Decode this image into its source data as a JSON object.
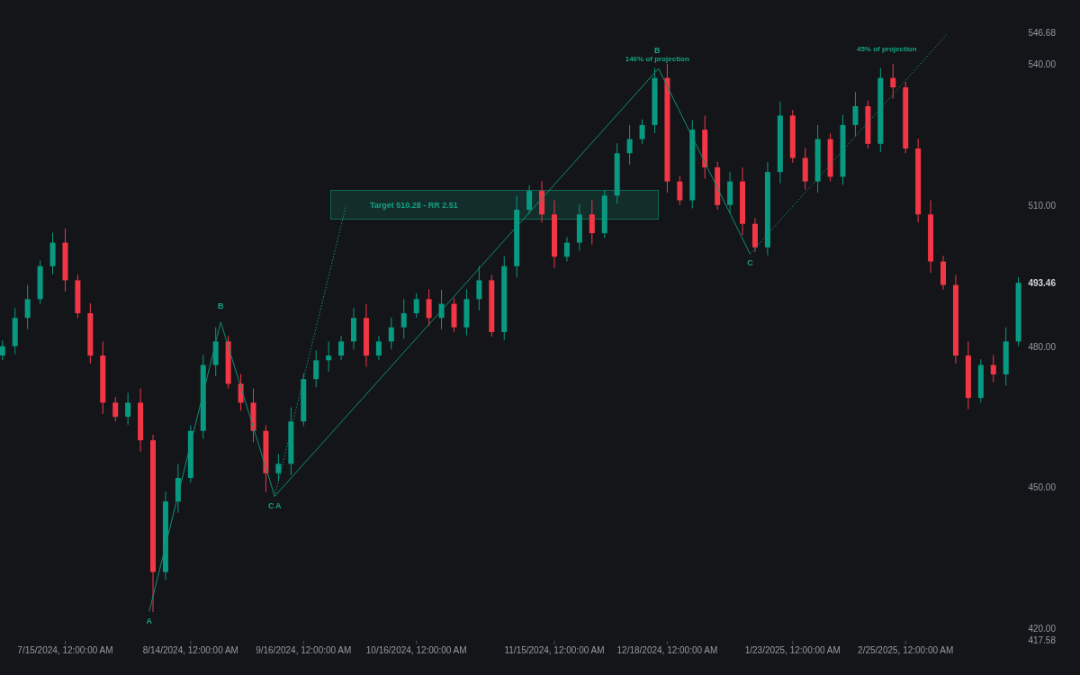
{
  "chart": {
    "chart_data": {
      "type": "candlestick",
      "ylim": [
        417.58,
        546.68
      ],
      "yticks": [
        {
          "value": 546.68,
          "label": "546.68"
        },
        {
          "value": 540,
          "label": "540.00"
        },
        {
          "value": 510,
          "label": "510.00"
        },
        {
          "value": 480,
          "label": "480.00"
        },
        {
          "value": 450,
          "label": "450.00"
        },
        {
          "value": 420,
          "label": "420.00"
        },
        {
          "value": 417.58,
          "label": "417.58"
        }
      ],
      "categories": [
        null,
        null,
        null,
        null,
        null,
        "7/15/2024, 12:00:00 AM",
        null,
        null,
        null,
        null,
        null,
        null,
        null,
        null,
        null,
        "8/14/2024, 12:00:00 AM",
        null,
        null,
        null,
        null,
        null,
        null,
        null,
        null,
        "9/16/2024, 12:00:00 AM",
        null,
        null,
        null,
        null,
        null,
        null,
        null,
        null,
        "10/16/2024, 12:00:00 AM",
        null,
        null,
        null,
        null,
        null,
        null,
        null,
        null,
        null,
        null,
        "11/15/2024, 12:00:00 AM",
        null,
        null,
        null,
        null,
        null,
        null,
        null,
        null,
        "12/18/2024, 12:00:00 AM",
        null,
        null,
        null,
        null,
        null,
        null,
        null,
        null,
        null,
        "1/23/2025, 12:00:00 AM",
        null,
        null,
        null,
        null,
        null,
        null,
        null,
        null,
        "2/25/2025, 12:00:00 AM",
        null,
        null,
        null,
        null,
        null,
        null,
        null,
        null,
        null
      ],
      "ohlc": [
        [
          478,
          481.2,
          477,
          480
        ],
        [
          480,
          488.1,
          478.3,
          486
        ],
        [
          486,
          493,
          483.6,
          490
        ],
        [
          490,
          498.2,
          489,
          497
        ],
        [
          497,
          504.1,
          495.3,
          502
        ],
        [
          502,
          505,
          491.6,
          494
        ],
        [
          494,
          495.2,
          486,
          487
        ],
        [
          487,
          489.1,
          476.3,
          478
        ],
        [
          478,
          481,
          465.6,
          468
        ],
        [
          468,
          469.2,
          464,
          465
        ],
        [
          465,
          470.1,
          463.3,
          468
        ],
        [
          468,
          471,
          457.6,
          460
        ],
        [
          460,
          461.2,
          423.5,
          432
        ],
        [
          432,
          449.1,
          430.3,
          447
        ],
        [
          447,
          455,
          444.6,
          452
        ],
        [
          452,
          463.2,
          451,
          462
        ],
        [
          462,
          478.1,
          460.3,
          476
        ],
        [
          476,
          484,
          473.6,
          481
        ],
        [
          481,
          482.2,
          471,
          472
        ],
        [
          472,
          474.1,
          466.3,
          468
        ],
        [
          468,
          471,
          459.6,
          462
        ],
        [
          462,
          463.2,
          449,
          453
        ],
        [
          453,
          457.1,
          451.3,
          455
        ],
        [
          455,
          467,
          452.6,
          464
        ],
        [
          464,
          474.2,
          463,
          473
        ],
        [
          473,
          479.1,
          471.3,
          477
        ],
        [
          477,
          481,
          474.6,
          478
        ],
        [
          478,
          482.2,
          477,
          481
        ],
        [
          481,
          488.1,
          479.3,
          486
        ],
        [
          486,
          489,
          475.6,
          478
        ],
        [
          478,
          482.2,
          477,
          481
        ],
        [
          481,
          486.1,
          479.3,
          484
        ],
        [
          484,
          490,
          481.6,
          487
        ],
        [
          487,
          491.2,
          486,
          490
        ],
        [
          490,
          492.1,
          484.3,
          486
        ],
        [
          486,
          492,
          483.6,
          489
        ],
        [
          489,
          490.2,
          483,
          484
        ],
        [
          484,
          492.1,
          482.3,
          490
        ],
        [
          490,
          497,
          487.6,
          494
        ],
        [
          494,
          495.2,
          482,
          483
        ],
        [
          483,
          499.1,
          481.3,
          497
        ],
        [
          497,
          512,
          494.6,
          509
        ],
        [
          509,
          514.2,
          508,
          513
        ],
        [
          513,
          515.1,
          506.3,
          508
        ],
        [
          508,
          511,
          496.6,
          499
        ],
        [
          499,
          503.2,
          498,
          502
        ],
        [
          502,
          510.1,
          500.3,
          508
        ],
        [
          508,
          511,
          501.6,
          504
        ],
        [
          504,
          513.2,
          503,
          512
        ],
        [
          512,
          523.1,
          510.3,
          521
        ],
        [
          521,
          527,
          518.6,
          524
        ],
        [
          524,
          528.2,
          523,
          527
        ],
        [
          527,
          539.1,
          525.3,
          537
        ],
        [
          537,
          540,
          512.6,
          515
        ],
        [
          515,
          516.2,
          510,
          511
        ],
        [
          511,
          528.1,
          509.3,
          526
        ],
        [
          526,
          529,
          515.6,
          518
        ],
        [
          518,
          519.2,
          509,
          510
        ],
        [
          510,
          517.1,
          508.3,
          515
        ],
        [
          515,
          518,
          503.6,
          506
        ],
        [
          506,
          507.2,
          500,
          501
        ],
        [
          501,
          519.1,
          499.3,
          517
        ],
        [
          517,
          532,
          514.6,
          529
        ],
        [
          529,
          530.2,
          519,
          520
        ],
        [
          520,
          522.1,
          513.3,
          515
        ],
        [
          515,
          527,
          512.6,
          524
        ],
        [
          524,
          525.2,
          515,
          516
        ],
        [
          516,
          529.1,
          514.3,
          527
        ],
        [
          527,
          534,
          524.6,
          531
        ],
        [
          531,
          532.2,
          522,
          523
        ],
        [
          523,
          539.1,
          521.3,
          537
        ],
        [
          537,
          540,
          532.6,
          535
        ],
        [
          535,
          536.2,
          521,
          522
        ],
        [
          522,
          524.1,
          506.3,
          508
        ],
        [
          508,
          511,
          495.6,
          498
        ],
        [
          498,
          499.2,
          492,
          493
        ],
        [
          493,
          495.1,
          476.3,
          478
        ],
        [
          478,
          481,
          466.6,
          469
        ],
        [
          469,
          477.2,
          468,
          476
        ],
        [
          476,
          478.1,
          472.3,
          474
        ],
        [
          474,
          484,
          471.6,
          481
        ],
        [
          481,
          494.7,
          480,
          493.46
        ]
      ]
    },
    "last_price": "493.46",
    "target": {
      "text": "Target 510.28 - RR 2.51"
    },
    "pattern_labels": [
      {
        "text": "A"
      },
      {
        "text": "B"
      },
      {
        "text": "C"
      },
      {
        "text": "A"
      },
      {
        "text": "B"
      },
      {
        "text": "C"
      }
    ],
    "projection_notes": [
      {
        "text": "146% of projection"
      },
      {
        "text": "45% of projection"
      }
    ]
  }
}
